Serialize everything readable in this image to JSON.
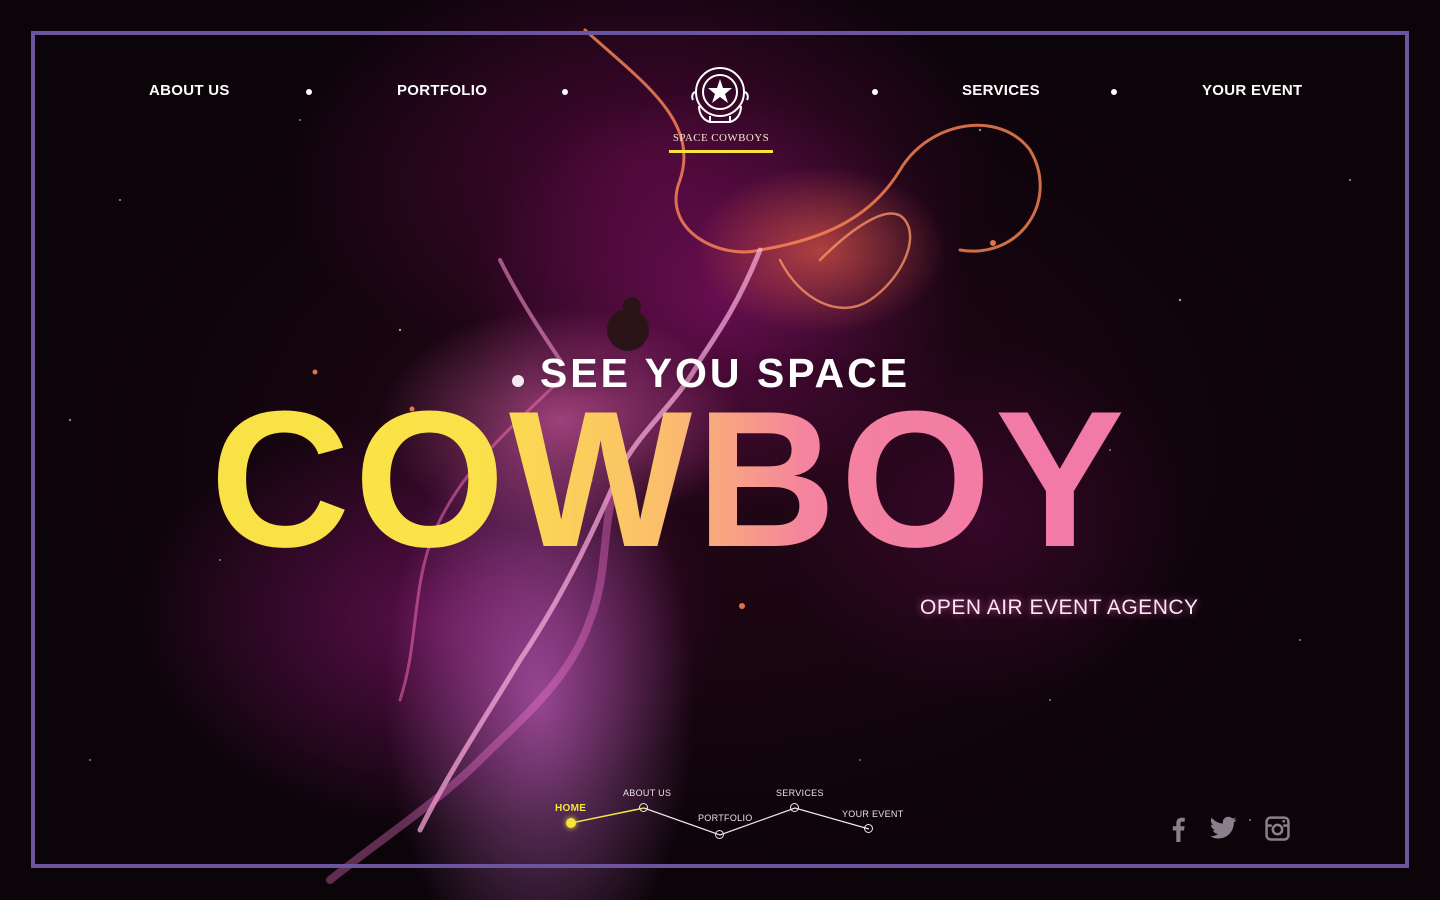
{
  "brand": {
    "name": "SPACE COWBOYS",
    "accent_color": "#f7e33a"
  },
  "nav": {
    "items": [
      {
        "label": "ABOUT US"
      },
      {
        "label": "PORTFOLIO"
      },
      {
        "label": "SERVICES"
      },
      {
        "label": "YOUR EVENT"
      }
    ]
  },
  "hero": {
    "subtitle": "SEE YOU SPACE",
    "title": "COWBOY",
    "tagline": "OPEN AIR EVENT AGENCY",
    "gradient_colors": [
      "#f8e245",
      "#f27aa6"
    ]
  },
  "step_nav": {
    "items": [
      {
        "label": "HOME",
        "active": true
      },
      {
        "label": "ABOUT US",
        "active": false
      },
      {
        "label": "PORTFOLIO",
        "active": false
      },
      {
        "label": "SERVICES",
        "active": false
      },
      {
        "label": "YOUR EVENT",
        "active": false
      }
    ]
  },
  "social": [
    {
      "icon": "facebook-icon"
    },
    {
      "icon": "twitter-icon"
    },
    {
      "icon": "instagram-icon"
    }
  ],
  "frame_color": "#6c559e"
}
